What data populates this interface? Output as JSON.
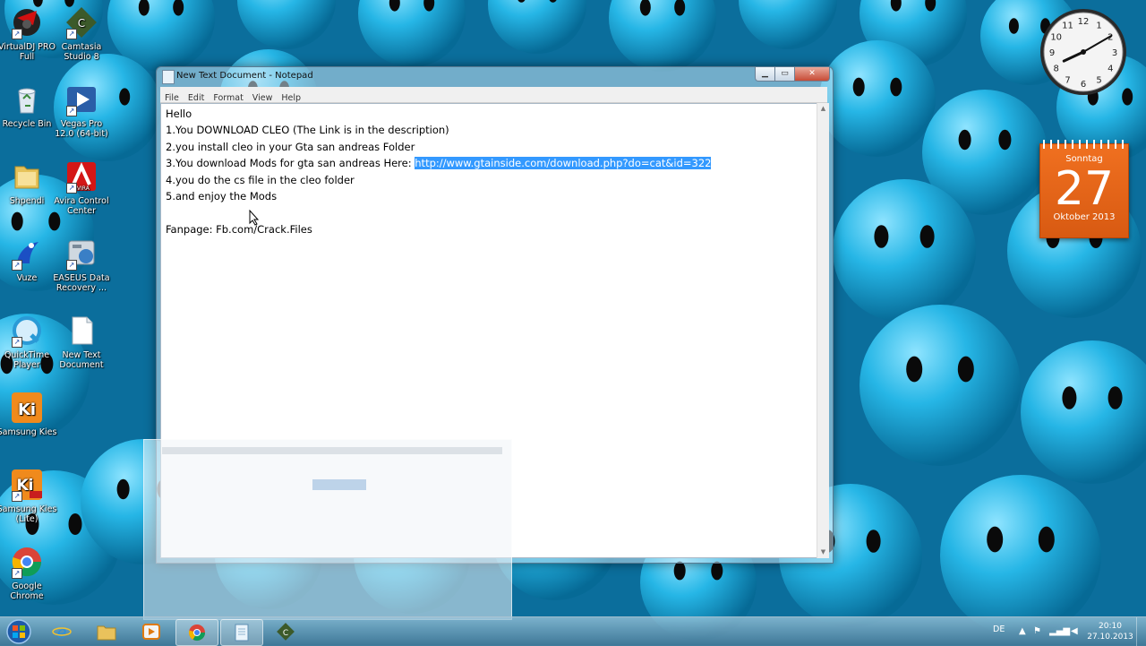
{
  "desktop": {
    "icons": [
      {
        "label": "VirtualDJ PRO Full",
        "icon": "virtualdj-icon"
      },
      {
        "label": "Camtasia Studio 8",
        "icon": "camtasia-icon"
      },
      {
        "label": "Recycle Bin",
        "icon": "recycle-bin-icon"
      },
      {
        "label": "Vegas Pro 12.0 (64-bit)",
        "icon": "vegas-pro-icon"
      },
      {
        "label": "Shpendi",
        "icon": "folder-icon"
      },
      {
        "label": "Avira Control Center",
        "icon": "avira-icon"
      },
      {
        "label": "Vuze",
        "icon": "vuze-icon"
      },
      {
        "label": "EASEUS Data Recovery ...",
        "icon": "easeus-icon"
      },
      {
        "label": "QuickTime Player",
        "icon": "quicktime-icon"
      },
      {
        "label": "New Text Document",
        "icon": "text-document-icon"
      },
      {
        "label": "Samsung Kies",
        "icon": "samsung-kies-icon"
      },
      {
        "label": "Samsung Kies (Lite)",
        "icon": "samsung-kies-lite-icon"
      },
      {
        "label": "Google Chrome",
        "icon": "chrome-icon"
      }
    ]
  },
  "calendar": {
    "weekday": "Sonntag",
    "day": "27",
    "month": "Oktober 2013",
    "color": "#f07020"
  },
  "clock_gadget": {
    "hours": 8,
    "minutes": 10
  },
  "notepad": {
    "title": "New Text Document - Notepad",
    "menu": [
      "File",
      "Edit",
      "Format",
      "View",
      "Help"
    ],
    "lines": [
      "Hello",
      "1.You DOWNLOAD CLEO (The Link is in the description)",
      "2.you install cleo in your Gta san andreas Folder",
      "3.You download Mods for gta san andreas Here: ",
      "4.you do the cs file in the cleo folder",
      "5.and enjoy the Mods",
      "",
      "Fanpage: Fb.com/Crack.Files"
    ],
    "selected_text": "http://www.gtainside.com/download.php?do=cat&id=322",
    "selection_color": "#3399ff"
  },
  "taskbar": {
    "items": [
      {
        "icon": "internet-explorer-icon",
        "active": false
      },
      {
        "icon": "file-explorer-icon",
        "active": false
      },
      {
        "icon": "media-player-icon",
        "active": false
      },
      {
        "icon": "chrome-icon",
        "active": true
      },
      {
        "icon": "notepad-icon",
        "active": true
      },
      {
        "icon": "camtasia-icon",
        "active": false
      }
    ],
    "language": "DE",
    "time": "20:10",
    "date": "27.10.2013"
  }
}
